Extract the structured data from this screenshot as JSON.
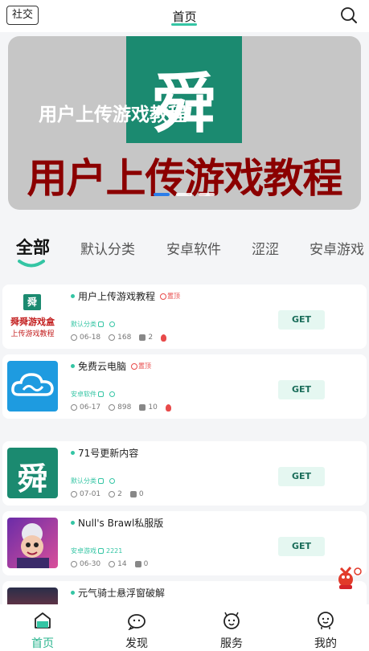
{
  "header": {
    "social_label": "社交",
    "title": "首页"
  },
  "banner": {
    "logo_char": "舜",
    "small_text": "用户上传游戏教程",
    "big_text": "用户上传游戏教程",
    "slide_count": 3,
    "active_slide": 1
  },
  "tabs": [
    {
      "label": "全部",
      "active": true
    },
    {
      "label": "默认分类"
    },
    {
      "label": "安卓软件"
    },
    {
      "label": "涩涩"
    },
    {
      "label": "安卓游戏"
    }
  ],
  "items": [
    {
      "title": "用户上传游戏教程",
      "badge": "置顶",
      "category": "默认分类",
      "date": "06-18",
      "views": "168",
      "likes": "2",
      "hot": true,
      "get_label": "GET",
      "icon_text1": "舜舜游戏盒",
      "icon_text2": "上传游戏教程"
    },
    {
      "title": "免费云电脑",
      "badge": "置顶",
      "category": "安卓软件",
      "date": "06-17",
      "views": "898",
      "likes": "10",
      "hot": true,
      "get_label": "GET"
    },
    {
      "title": "71号更新内容",
      "category": "默认分类",
      "date": "07-01",
      "views": "2",
      "likes": "0",
      "get_label": "GET",
      "icon_text1": "舜"
    },
    {
      "title": "Null's Brawl私服版",
      "category": "安卓游戏",
      "extra": "2221",
      "date": "06-30",
      "views": "14",
      "likes": "0",
      "get_label": "GET"
    },
    {
      "title": "元气骑士悬浮窗破解"
    }
  ],
  "nav": [
    {
      "label": "首页",
      "icon": "home-icon",
      "active": true
    },
    {
      "label": "发现",
      "icon": "discover-icon"
    },
    {
      "label": "服务",
      "icon": "service-icon"
    },
    {
      "label": "我的",
      "icon": "profile-icon"
    }
  ],
  "colors": {
    "accent": "#34c5a4",
    "banner_text_red": "#8b0000",
    "logo_green": "#1b8a70",
    "hot_red": "#e84a4a"
  }
}
